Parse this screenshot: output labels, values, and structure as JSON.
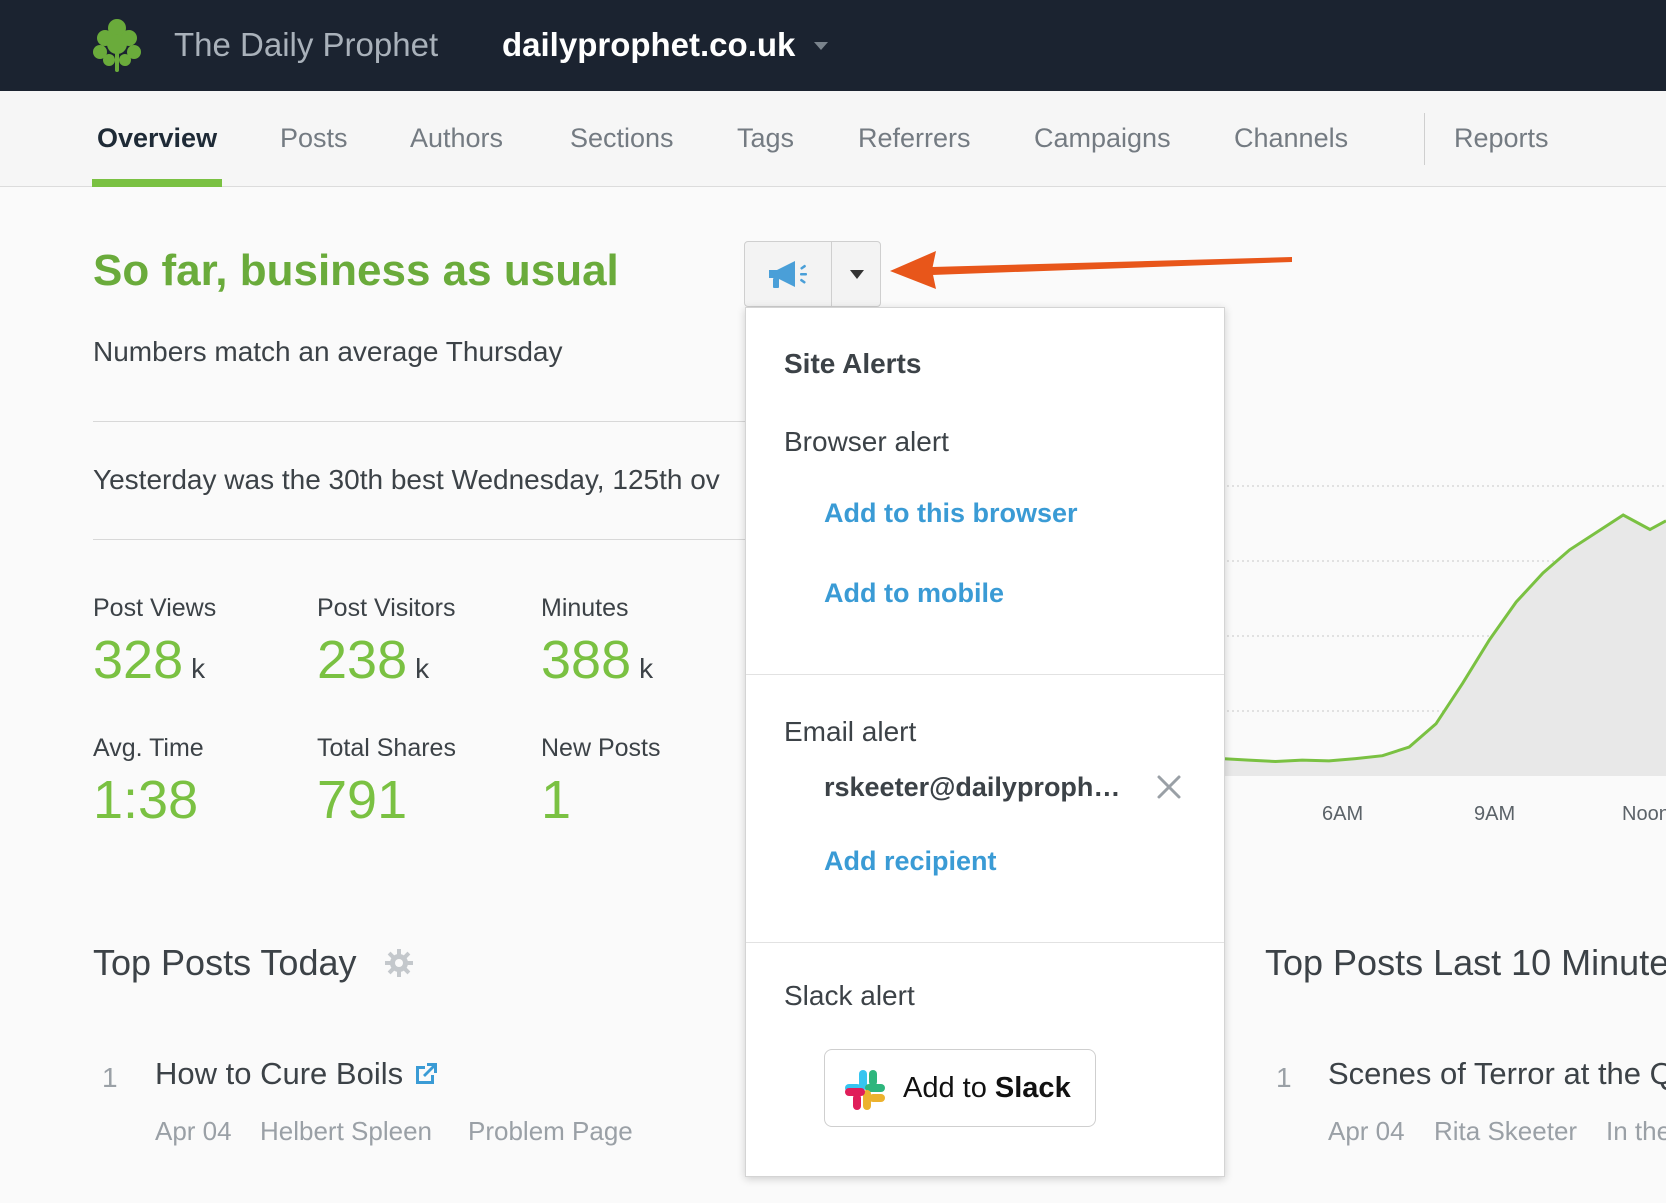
{
  "header": {
    "brand": "The Daily Prophet",
    "domain": "dailyprophet.co.uk",
    "logo": "parsley-leaf-icon"
  },
  "nav": {
    "items": [
      {
        "label": "Overview",
        "active": true
      },
      {
        "label": "Posts"
      },
      {
        "label": "Authors"
      },
      {
        "label": "Sections"
      },
      {
        "label": "Tags"
      },
      {
        "label": "Referrers"
      },
      {
        "label": "Campaigns"
      },
      {
        "label": "Channels"
      },
      {
        "label": "Reports"
      }
    ]
  },
  "summary": {
    "headline": "So far, business as usual",
    "subline": "Numbers match an average Thursday",
    "yesterday": "Yesterday was the 30th best Wednesday, 125th ov"
  },
  "stats": [
    {
      "label": "Post Views",
      "value": "328",
      "unit": "k"
    },
    {
      "label": "Post Visitors",
      "value": "238",
      "unit": "k"
    },
    {
      "label": "Minutes",
      "value": "388",
      "unit": "k"
    },
    {
      "label": "Avg. Time",
      "value": "1:38",
      "unit": ""
    },
    {
      "label": "Total Shares",
      "value": "791",
      "unit": ""
    },
    {
      "label": "New Posts",
      "value": "1",
      "unit": ""
    }
  ],
  "chart_data": {
    "type": "area",
    "x_ticks": [
      "6AM",
      "9AM",
      "Noon"
    ],
    "grid": true,
    "series": [
      {
        "x": [
          4.0,
          4.5,
          5.0,
          5.5,
          6.0,
          6.5,
          7.0,
          7.5,
          8.0,
          8.5,
          9.0,
          9.5,
          10.0,
          10.5,
          11.0,
          11.5,
          12.0,
          12.3
        ],
        "values": [
          6,
          5.5,
          5,
          5.5,
          5.2,
          6,
          7,
          10,
          18,
          32,
          47,
          60,
          70,
          78,
          84,
          90,
          85,
          88
        ]
      }
    ],
    "color": "#7ac142"
  },
  "top_posts_today": {
    "title": "Top Posts Today",
    "items": [
      {
        "rank": "1",
        "title": "How to Cure Boils",
        "date": "Apr 04",
        "author": "Helbert Spleen",
        "section": "Problem Page"
      }
    ]
  },
  "top_posts_10min": {
    "title": "Top Posts Last 10 Minute",
    "items": [
      {
        "rank": "1",
        "title": "Scenes of Terror at the Q",
        "date": "Apr 04",
        "author": "Rita Skeeter",
        "section": "In the"
      }
    ]
  },
  "alerts": {
    "button_icon": "megaphone-icon",
    "menu_title": "Site Alerts",
    "browser_label": "Browser alert",
    "add_browser": "Add to this browser",
    "add_mobile": "Add to mobile",
    "email_label": "Email alert",
    "email_recipient": "rskeeter@dailyproph…",
    "add_recipient": "Add recipient",
    "slack_label": "Slack alert",
    "slack_button_prefix": "Add to",
    "slack_button_brand": "Slack"
  },
  "colors": {
    "accent_green": "#7ac142",
    "link_blue": "#3a9bd5",
    "topbar": "#1b2330",
    "arrow": "#e8561a"
  }
}
